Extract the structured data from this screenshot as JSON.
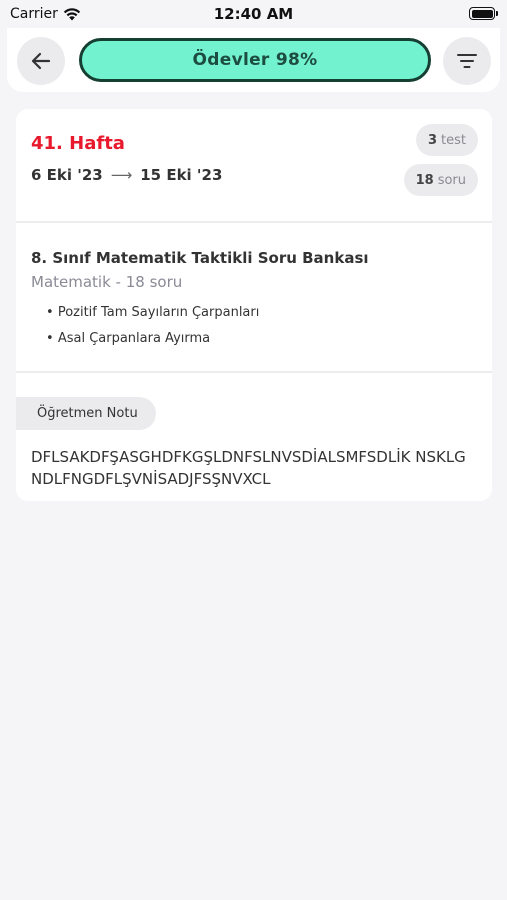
{
  "status_bar": {
    "carrier": "Carrier",
    "time": "12:40 AM"
  },
  "header": {
    "title": "Ödevler 98%",
    "progress_percent": 98,
    "accent_color": "#72f2cf",
    "back_icon": "arrow-left-icon",
    "filter_icon": "filter-icon"
  },
  "week_card": {
    "title": "41. Hafta",
    "start_date": "6 Eki '23",
    "arrow": "⟶",
    "end_date": "15 Eki '23",
    "test_count": "3",
    "test_label": "test",
    "question_count": "18",
    "question_label": "soru"
  },
  "assignment": {
    "book_title": "8. Sınıf Matematik Taktikli Soru Bankası",
    "subject": "Matematik - 18 soru",
    "topics": [
      "Pozitif Tam Sayıların Çarpanları",
      "Asal Çarpanlara Ayırma"
    ]
  },
  "teacher_note": {
    "label": "Öğretmen Notu",
    "text": "DFLSAKDFŞASGHDFKGŞLDNFSLNVSDİALSMFSDLİK NSKLGNDLFNGDFLŞVNİSADJFSŞNVXCL"
  }
}
